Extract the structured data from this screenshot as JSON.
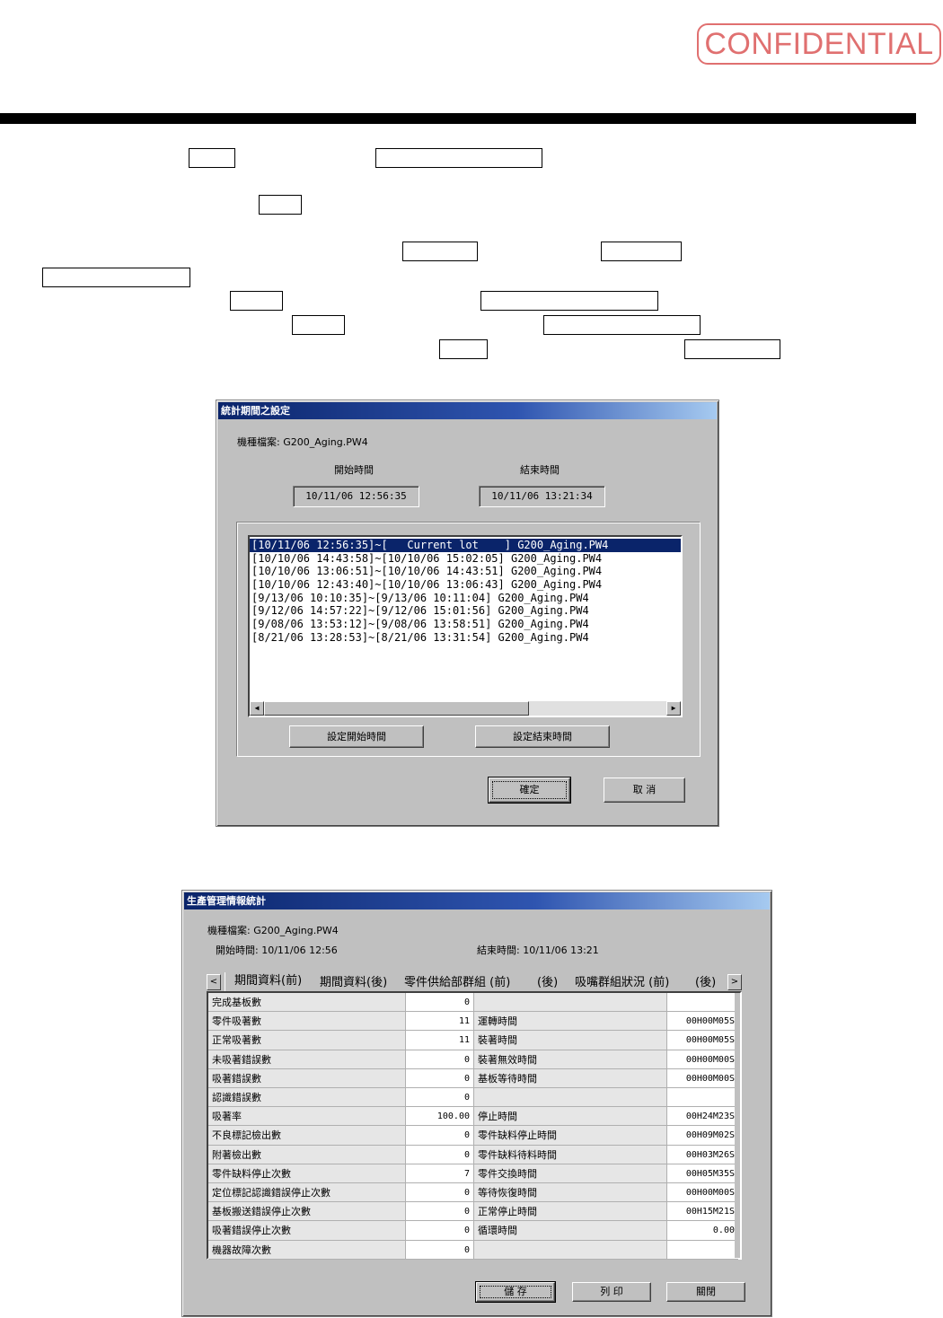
{
  "stamp": "CONFIDENTIAL",
  "dialog1": {
    "title": "統計期間之設定",
    "file_label": "機種檔案: G200_Aging.PW4",
    "start_label": "開始時間",
    "end_label": "結束時間",
    "start_value": "10/11/06 12:56:35",
    "end_value": "10/11/06 13:21:34",
    "list_items": [
      "[10/11/06 12:56:35]~[   Current lot    ] G200_Aging.PW4",
      "[10/10/06 14:43:58]~[10/10/06 15:02:05] G200_Aging.PW4",
      "[10/10/06 13:06:51]~[10/10/06 14:43:51] G200_Aging.PW4",
      "[10/10/06 12:43:40]~[10/10/06 13:06:43] G200_Aging.PW4",
      "[9/13/06 10:10:35]~[9/13/06 10:11:04] G200_Aging.PW4",
      "[9/12/06 14:57:22]~[9/12/06 15:01:56] G200_Aging.PW4",
      "[9/08/06 13:53:12]~[9/08/06 13:58:51] G200_Aging.PW4",
      "[8/21/06 13:28:53]~[8/21/06 13:31:54] G200_Aging.PW4"
    ],
    "set_start_button": "設定開始時間",
    "set_end_button": "設定結束時間",
    "ok_button": "確定",
    "cancel_button": "取 消"
  },
  "dialog2": {
    "title": "生產管理情報統計",
    "file_label": "機種檔案: G200_Aging.PW4",
    "start_label": "開始時間: 10/11/06 12:56",
    "end_label": "結束時間: 10/11/06 13:21",
    "tabs": [
      "期間資料(前)",
      "期間資料(後)",
      "零件供給部群組 (前)",
      "(後)",
      "吸嘴群組狀況 (前)",
      "(後)"
    ],
    "rows": [
      [
        "完成基板數",
        "0",
        "",
        ""
      ],
      [
        "零件吸著數",
        "11",
        "運轉時間",
        "00H00M05S"
      ],
      [
        "正常吸著數",
        "11",
        "裝著時間",
        "00H00M05S"
      ],
      [
        "未吸著錯誤數",
        "0",
        "裝著無效時間",
        "00H00M00S"
      ],
      [
        "吸著錯誤數",
        "0",
        "基板等待時間",
        "00H00M00S"
      ],
      [
        "認識錯誤數",
        "0",
        "",
        ""
      ],
      [
        "吸著率",
        "100.00",
        "停止時間",
        "00H24M23S"
      ],
      [
        "不良標記檢出數",
        "0",
        "零件缺料停止時間",
        "00H09M02S"
      ],
      [
        "附著檢出數",
        "0",
        "零件缺料待料時間",
        "00H03M26S"
      ],
      [
        "零件缺料停止次數",
        "7",
        "零件交換時間",
        "00H05M35S"
      ],
      [
        "定位標記認識錯誤停止次數",
        "0",
        "等待恢復時間",
        "00H00M00S"
      ],
      [
        "基板搬送錯誤停止次數",
        "0",
        "正常停止時間",
        "00H15M21S"
      ],
      [
        "吸著錯誤停止次數",
        "0",
        "循環時間",
        "0.00"
      ],
      [
        "機器故障次數",
        "0",
        "",
        ""
      ]
    ],
    "save_button": "儲 存",
    "print_button": "列 印",
    "close_button": "關閉"
  }
}
